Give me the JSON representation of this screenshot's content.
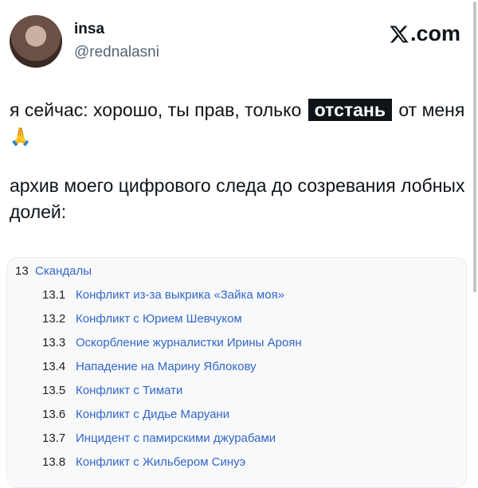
{
  "author": {
    "display_name": "insa",
    "handle": "@rednalasni"
  },
  "brand": {
    "label": ".com",
    "icon": "x-logo-icon"
  },
  "tweet": {
    "line1_before": "я сейчас: хорошо, ты прав, только",
    "highlight": "отстань",
    "line1_after": "от меня",
    "emoji": "🙏",
    "paragraph2": "архив моего цифрового следа до созревания лобных долей:"
  },
  "toc": {
    "number": "13",
    "title": "Скандалы",
    "items": [
      {
        "num": "13.1",
        "label": "Конфликт из-за выкрика «Зайка моя»"
      },
      {
        "num": "13.2",
        "label": "Конфликт с Юрием Шевчуком"
      },
      {
        "num": "13.3",
        "label": "Оскорбление журналистки Ирины Ароян"
      },
      {
        "num": "13.4",
        "label": "Нападение на Марину Яблокову"
      },
      {
        "num": "13.5",
        "label": "Конфликт с Тимати"
      },
      {
        "num": "13.6",
        "label": "Конфликт с Дидье Маруани"
      },
      {
        "num": "13.7",
        "label": "Инцидент с памирскими джурабами"
      },
      {
        "num": "13.8",
        "label": "Конфликт с Жильбером Синуэ"
      }
    ]
  },
  "colors": {
    "link": "#3366cc",
    "text": "#0f1419",
    "handle": "#536471"
  }
}
